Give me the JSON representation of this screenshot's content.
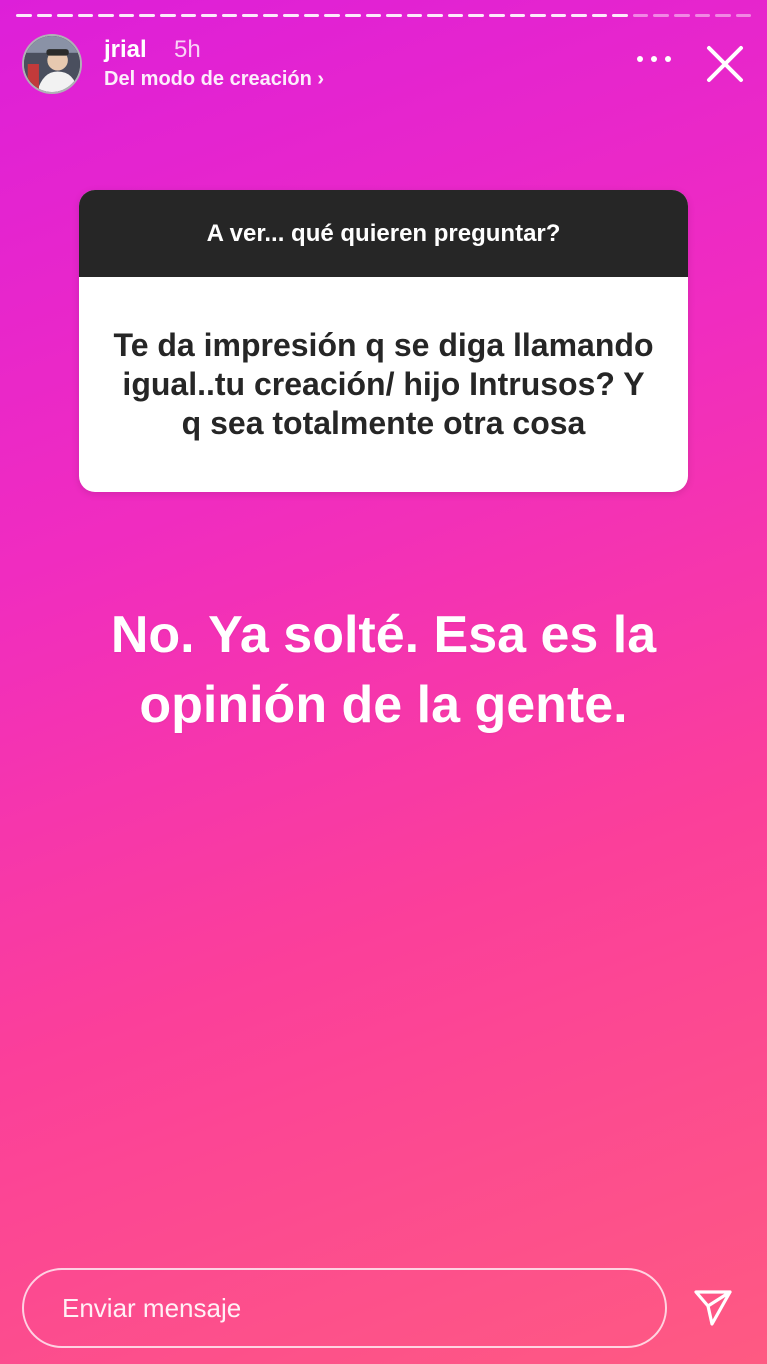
{
  "story": {
    "username": "jrial",
    "time": "5h",
    "subtitle": "Del modo de creación ›",
    "progress_segments": 36,
    "progress_seen": 30
  },
  "question_box": {
    "prompt": "A ver... qué quieren preguntar?",
    "question": "Te da impresión q se diga llamando igual..tu creación/ hijo Intrusos? Y q sea totalmente otra cosa"
  },
  "answer_text": "No. Ya solté. Esa es la opinión de la gente.",
  "composer": {
    "placeholder": "Enviar mensaje"
  },
  "icons": [
    "more-icon",
    "close-icon",
    "send-icon"
  ],
  "colors": {
    "gradient_start": "#dd1fd9",
    "gradient_end": "#fe5a82",
    "box_header": "#262626"
  }
}
